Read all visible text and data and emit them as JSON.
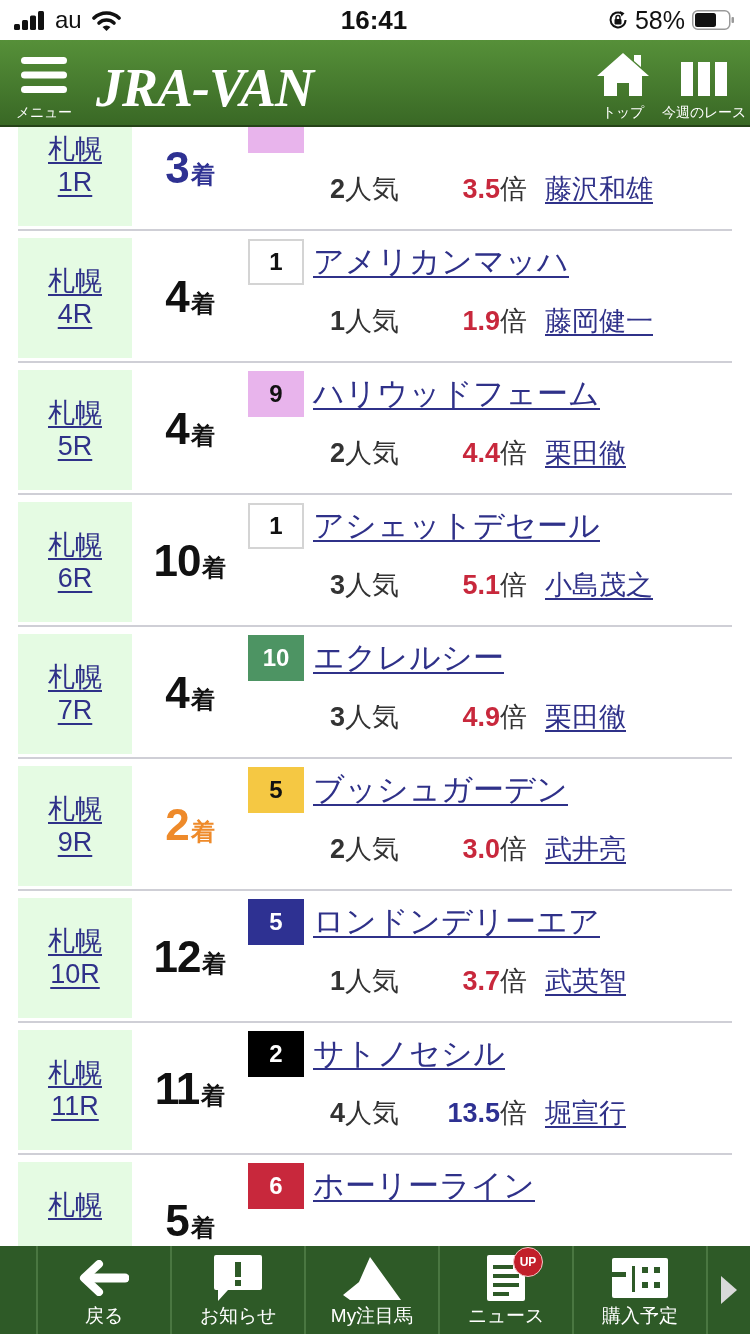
{
  "status_bar": {
    "carrier": "au",
    "time": "16:41",
    "battery": "58%"
  },
  "header": {
    "menu_label": "メニュー",
    "logo": "JRA-VAN",
    "actions": [
      {
        "kind": "home",
        "label": "トップ"
      },
      {
        "kind": "columns",
        "label": "今週のレース"
      }
    ]
  },
  "results": [
    {
      "kind": "cut-top",
      "venue": "札幌",
      "race": "1R",
      "finish": {
        "place": "3",
        "unit": "着",
        "color": "#2e3192"
      },
      "horse": {
        "color": "#e8b4ec"
      },
      "popularity": {
        "rank": "2",
        "unit": "人気"
      },
      "odds": {
        "value": "3.5",
        "unit": "倍",
        "color": "#c8283c"
      },
      "jockey": "藤沢和雄"
    },
    {
      "kind": "full",
      "venue": "札幌",
      "race": "4R",
      "finish": {
        "place": "4",
        "unit": "着",
        "color": "#111111"
      },
      "horse": {
        "number": "1",
        "name": "アメリカンマッハ",
        "color": "#ffffff"
      },
      "popularity": {
        "rank": "1",
        "unit": "人気"
      },
      "odds": {
        "value": "1.9",
        "unit": "倍",
        "color": "#c8283c"
      },
      "jockey": "藤岡健一"
    },
    {
      "kind": "full",
      "venue": "札幌",
      "race": "5R",
      "finish": {
        "place": "4",
        "unit": "着",
        "color": "#111111"
      },
      "horse": {
        "number": "9",
        "name": "ハリウッドフェーム",
        "color": "#e8b4ec"
      },
      "popularity": {
        "rank": "2",
        "unit": "人気"
      },
      "odds": {
        "value": "4.4",
        "unit": "倍",
        "color": "#c8283c"
      },
      "jockey": "栗田徹"
    },
    {
      "kind": "full",
      "venue": "札幌",
      "race": "6R",
      "finish": {
        "place": "10",
        "unit": "着",
        "color": "#111111"
      },
      "horse": {
        "number": "1",
        "name": "アシェットデセール",
        "color": "#ffffff"
      },
      "popularity": {
        "rank": "3",
        "unit": "人気"
      },
      "odds": {
        "value": "5.1",
        "unit": "倍",
        "color": "#c8283c"
      },
      "jockey": "小島茂之"
    },
    {
      "kind": "full",
      "venue": "札幌",
      "race": "7R",
      "finish": {
        "place": "4",
        "unit": "着",
        "color": "#111111"
      },
      "horse": {
        "number": "10",
        "name": "エクレルシー",
        "color": "#4d9463"
      },
      "popularity": {
        "rank": "3",
        "unit": "人気"
      },
      "odds": {
        "value": "4.9",
        "unit": "倍",
        "color": "#c8283c"
      },
      "jockey": "栗田徹"
    },
    {
      "kind": "full",
      "venue": "札幌",
      "race": "9R",
      "finish": {
        "place": "2",
        "unit": "着",
        "color": "#ee8a2a"
      },
      "horse": {
        "number": "5",
        "name": "ブッシュガーデン",
        "color": "#f5c843"
      },
      "popularity": {
        "rank": "2",
        "unit": "人気"
      },
      "odds": {
        "value": "3.0",
        "unit": "倍",
        "color": "#c8283c"
      },
      "jockey": "武井亮"
    },
    {
      "kind": "full",
      "venue": "札幌",
      "race": "10R",
      "finish": {
        "place": "12",
        "unit": "着",
        "color": "#111111"
      },
      "horse": {
        "number": "5",
        "name": "ロンドンデリーエア",
        "color": "#2e3192"
      },
      "popularity": {
        "rank": "1",
        "unit": "人気"
      },
      "odds": {
        "value": "3.7",
        "unit": "倍",
        "color": "#c8283c"
      },
      "jockey": "武英智"
    },
    {
      "kind": "full",
      "venue": "札幌",
      "race": "11R",
      "finish": {
        "place": "11",
        "unit": "着",
        "color": "#111111"
      },
      "horse": {
        "number": "2",
        "name": "サトノセシル",
        "color": "#000000"
      },
      "popularity": {
        "rank": "4",
        "unit": "人気"
      },
      "odds": {
        "value": "13.5",
        "unit": "倍",
        "color": "#2e3192"
      },
      "jockey": "堀宣行"
    },
    {
      "kind": "cut-bottom",
      "venue": "札幌",
      "finish": {
        "place": "5",
        "unit": "着",
        "color": "#111111"
      },
      "horse": {
        "number": "6",
        "name": "ホーリーライン",
        "color": "#c8283c"
      }
    }
  ],
  "bottom_nav": [
    {
      "kind": "back",
      "label": "戻る"
    },
    {
      "kind": "notice",
      "label": "お知らせ"
    },
    {
      "kind": "favorite",
      "label": "My注目馬"
    },
    {
      "kind": "news",
      "label": "ニュース",
      "badge": "UP"
    },
    {
      "kind": "purchase",
      "label": "購入予定"
    }
  ]
}
